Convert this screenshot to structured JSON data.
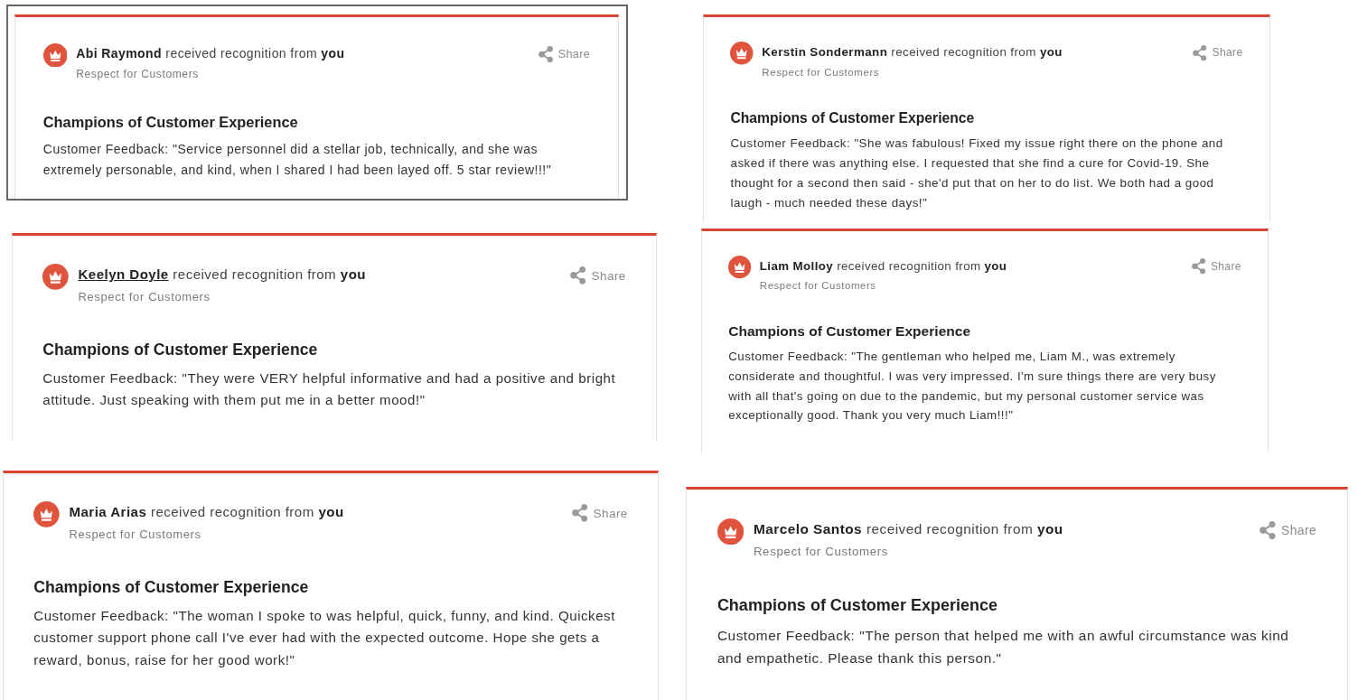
{
  "cards": [
    {
      "recipient": "Abi Raymond",
      "hovered": false,
      "headline": "received recognition from **you**",
      "value": "Respect for Customers",
      "share": "Share",
      "award": "Champions of Customer Experience",
      "feedback": "Customer Feedback: \"Service personnel did a stellar job, technically, and she was extremely personable, and kind, when I shared I had been layed off. 5 star review!!!\"",
      "highlighted": true
    },
    {
      "recipient": "Kerstin Sondermann",
      "hovered": false,
      "headline": "received recognition from **you**",
      "value": "Respect for Customers",
      "share": "Share",
      "award": "Champions of Customer Experience",
      "feedback": "Customer Feedback: \"She was fabulous! Fixed my issue right there on the phone and asked if there was anything else. I requested that she find a cure for Covid-19. She thought for a second then said - she'd put that on her to do list. We both had a good laugh - much needed these days!\"",
      "highlighted": false
    },
    {
      "recipient": "Keelyn Doyle",
      "hovered": true,
      "headline": "received recognition from **you**",
      "value": "Respect for Customers",
      "share": "Share",
      "award": "Champions of Customer Experience",
      "feedback": "Customer Feedback: \"They were VERY helpful informative and had a positive and bright attitude. Just speaking with them put me in a better mood!\"",
      "highlighted": false
    },
    {
      "recipient": "Liam Molloy",
      "hovered": false,
      "headline": "received recognition from **you**",
      "value": "Respect for Customers",
      "share": "Share",
      "award": "Champions of Customer Experience",
      "feedback": "Customer Feedback: \"The gentleman who helped me, Liam M., was extremely considerate and thoughtful. I was very impressed. I'm sure things there are very busy with all that's going on due to the pandemic, but my personal customer service was exceptionally good. Thank you very much Liam!!!\"",
      "highlighted": false
    },
    {
      "recipient": "Maria Arias",
      "hovered": false,
      "headline": "received recognition from **you**",
      "value": "Respect for Customers",
      "share": "Share",
      "award": "Champions of Customer Experience",
      "feedback": "Customer Feedback: \"The woman I spoke to was helpful, quick, funny, and kind. Quickest customer support phone call I've ever had with the expected outcome. Hope she gets a reward, bonus, raise for her good work!\"",
      "highlighted": false
    },
    {
      "recipient": "Marcelo Santos",
      "hovered": false,
      "headline": "received recognition from **you**",
      "value": "Respect for Customers",
      "share": "Share",
      "award": "Champions of Customer Experience",
      "feedback": "Customer Feedback: \"The person that helped me with an awful circumstance was kind and empathetic. Please thank this person.\"",
      "highlighted": false
    }
  ]
}
